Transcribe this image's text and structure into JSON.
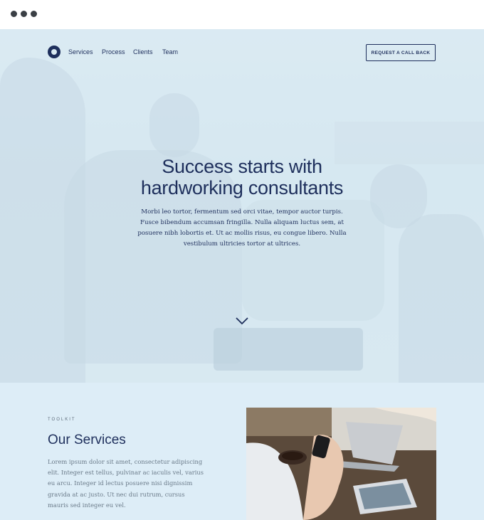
{
  "nav": {
    "links": [
      "Services",
      "Process",
      "Clients",
      "Team"
    ],
    "cta_label": "REQUEST A CALL BACK"
  },
  "hero": {
    "title_line1": "Success starts with",
    "title_line2": "hardworking consultants",
    "text": "Morbi leo tortor, fermentum sed orci vitae, tempor auctor turpis. Fusce bibendum accumsan fringilla. Nulla aliquam luctus sem, at posuere nibh lobortis et. Ut ac mollis risus, eu congue libero. Nulla vestibulum ultricies tortor at ultrices."
  },
  "services": {
    "kicker": "TOOLKIT",
    "title": "Our Services",
    "text": "Lorem ipsum dolor sit amet, consectetur adipiscing elit. Integer est tellus, pulvinar ac iaculis vel, varius eu arcu. Integer id lectus posuere nisi dignissim gravida at ac justo. Ut nec dui rutrum, cursus mauris sed integer eu vel."
  },
  "colors": {
    "brand_navy": "#1e2f5c",
    "hero_tint": "#dbeaf2",
    "section_bg": "#ddedf7"
  }
}
